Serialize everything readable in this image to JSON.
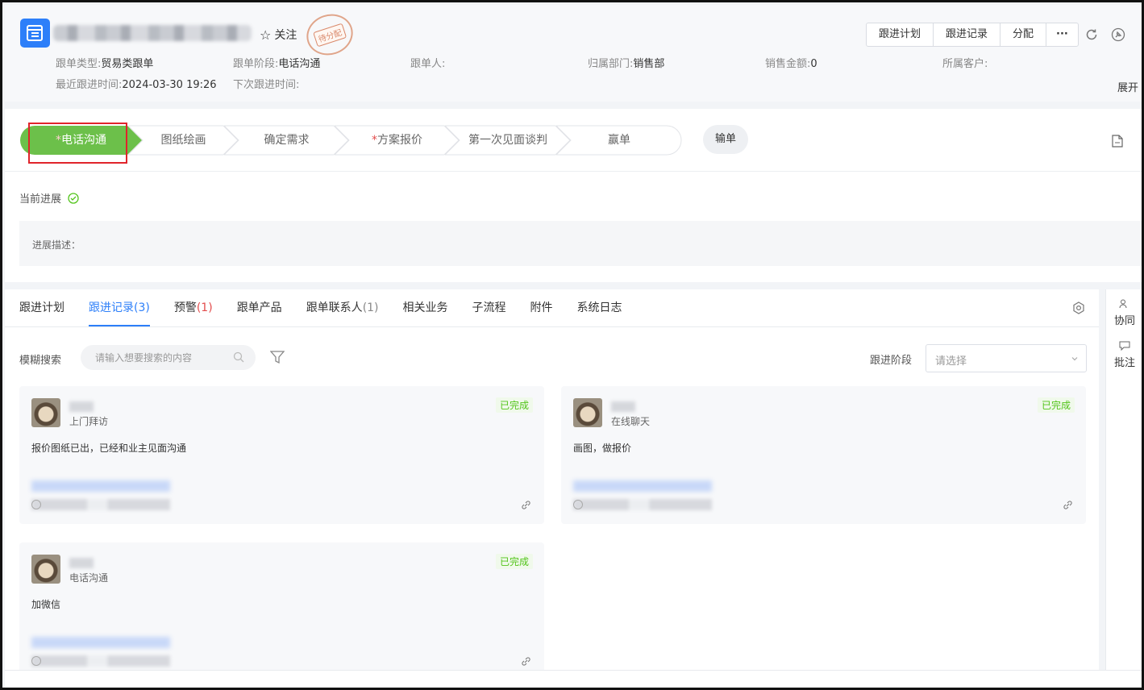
{
  "header": {
    "follow_label": "关注",
    "stamp_label": "待分配",
    "toolbar": [
      "跟进计划",
      "跟进记录",
      "分配",
      "···"
    ],
    "meta_row1": [
      {
        "label": "跟单类型:",
        "value": "贸易类跟单"
      },
      {
        "label": "跟单阶段:",
        "value": "电话沟通"
      },
      {
        "label": "跟单人:",
        "value": ""
      },
      {
        "label": "归属部门:",
        "value": "销售部"
      },
      {
        "label": "销售金额:",
        "value": "0"
      },
      {
        "label": "所属客户:",
        "value": ""
      }
    ],
    "meta_row2": [
      {
        "label": "最近跟进时间:",
        "value": "2024-03-30 19:26"
      },
      {
        "label": "下次跟进时间:",
        "value": ""
      }
    ],
    "expand_label": "展开"
  },
  "stages": {
    "steps": [
      {
        "label": "电话沟通",
        "required": true,
        "active": true
      },
      {
        "label": "图纸绘画",
        "required": false,
        "active": false
      },
      {
        "label": "确定需求",
        "required": false,
        "active": false
      },
      {
        "label": "方案报价",
        "required": true,
        "active": false
      },
      {
        "label": "第一次见面谈判",
        "required": false,
        "active": false
      },
      {
        "label": "赢单",
        "required": false,
        "active": false
      }
    ],
    "lose_label": "输单",
    "current_progress_label": "当前进展",
    "desc_label": "进展描述："
  },
  "main": {
    "tabs": [
      {
        "label": "跟进计划",
        "count": ""
      },
      {
        "label": "跟进记录",
        "count": "(3)"
      },
      {
        "label": "预警",
        "count": "(1)"
      },
      {
        "label": "跟单产品",
        "count": ""
      },
      {
        "label": "跟单联系人",
        "count": "(1)"
      },
      {
        "label": "相关业务",
        "count": ""
      },
      {
        "label": "子流程",
        "count": ""
      },
      {
        "label": "附件",
        "count": ""
      },
      {
        "label": "系统日志",
        "count": ""
      }
    ],
    "search_label": "模糊搜索",
    "search_placeholder": "请输入想要搜索的内容",
    "stage_filter_label": "跟进阶段",
    "stage_select_placeholder": "请选择",
    "records": [
      {
        "type": "上门拜访",
        "status": "已完成",
        "content": "报价图纸已出，已经和业主见面沟通"
      },
      {
        "type": "在线聊天",
        "status": "已完成",
        "content": "画图，做报价"
      },
      {
        "type": "电话沟通",
        "status": "已完成",
        "content": "加微信"
      }
    ]
  },
  "rail": {
    "items": [
      "协同",
      "批注"
    ]
  },
  "colors": {
    "accent": "#2d7ff9",
    "active_stage": "#6cc04a",
    "required": "#e34d4d",
    "done": "#52c41a",
    "highlight": "#e0242b"
  }
}
